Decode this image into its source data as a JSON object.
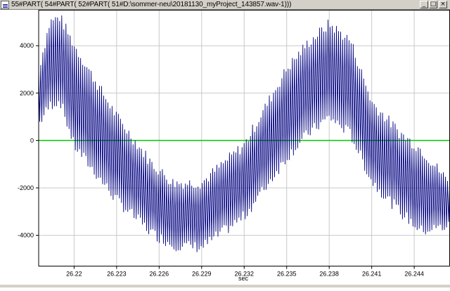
{
  "window": {
    "title": "55#PART( 54#PART( 52#PART( 51#D:\\sommer-neu\\20181130_myProject_143857.wav-1)))",
    "buttons": {
      "minimize": "_",
      "maximize": "□",
      "close": "×"
    }
  },
  "colors": {
    "signal": "#000080",
    "zero_line": "#00cc00",
    "grid": "#c8c8c8",
    "titlebar": "#d4d0c8"
  },
  "chart_data": {
    "type": "line",
    "title": "",
    "xlabel": "sec",
    "ylabel": "",
    "xlim": [
      26.2175,
      26.2465
    ],
    "ylim": [
      -5300,
      5500
    ],
    "x_ticks": [
      "26.22",
      "26.223",
      "26.226",
      "26.229",
      "26.232",
      "26.235",
      "26.238",
      "26.241",
      "26.244"
    ],
    "x_tick_values": [
      26.22,
      26.223,
      26.226,
      26.229,
      26.232,
      26.235,
      26.238,
      26.241,
      26.244
    ],
    "y_ticks": [
      "4000",
      "2000",
      "0",
      "-2000",
      "-4000"
    ],
    "y_tick_values": [
      4000,
      2000,
      0,
      -2000,
      -4000
    ],
    "grid": true,
    "zero_line": true,
    "series": [
      {
        "envelope_upper": [
          [
            26.2175,
            3000
          ],
          [
            26.2183,
            5000
          ],
          [
            26.219,
            5200
          ],
          [
            26.22,
            4000
          ],
          [
            26.223,
            1000
          ],
          [
            26.2255,
            -1000
          ],
          [
            26.227,
            -1800
          ],
          [
            26.229,
            -1800
          ],
          [
            26.232,
            -200
          ],
          [
            26.235,
            3000
          ],
          [
            26.2365,
            4100
          ],
          [
            26.238,
            4900
          ],
          [
            26.2395,
            4200
          ],
          [
            26.241,
            1600
          ],
          [
            26.243,
            300
          ],
          [
            26.2445,
            -400
          ],
          [
            26.2465,
            -1800
          ]
        ],
        "envelope_lower": [
          [
            26.2175,
            700
          ],
          [
            26.2183,
            1500
          ],
          [
            26.219,
            1700
          ],
          [
            26.22,
            -200
          ],
          [
            26.223,
            -2500
          ],
          [
            26.2255,
            -3900
          ],
          [
            26.227,
            -4400
          ],
          [
            26.229,
            -4500
          ],
          [
            26.232,
            -3200
          ],
          [
            26.235,
            -700
          ],
          [
            26.2365,
            300
          ],
          [
            26.238,
            1000
          ],
          [
            26.2395,
            300
          ],
          [
            26.241,
            -1700
          ],
          [
            26.243,
            -3000
          ],
          [
            26.2445,
            -3800
          ],
          [
            26.2465,
            -3600
          ]
        ],
        "oscillations": 196
      }
    ]
  }
}
